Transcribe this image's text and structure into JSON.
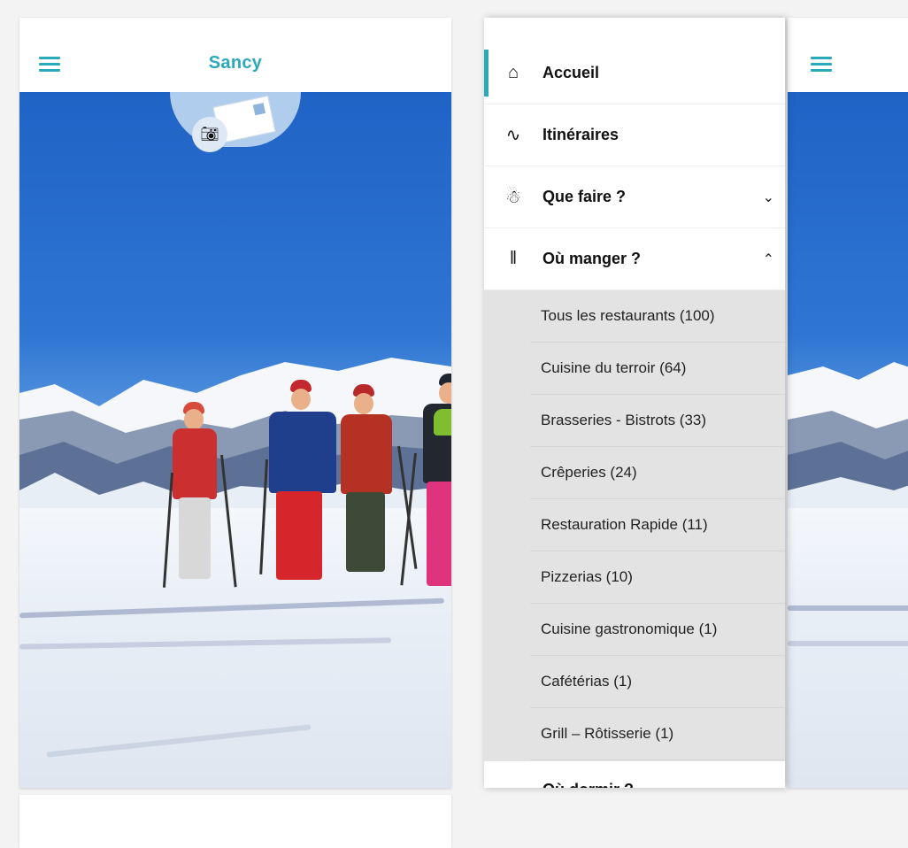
{
  "left_screen": {
    "title": "Sancy",
    "menu_icon": "hamburger-menu-icon",
    "camera_icon": "camera-icon",
    "postcard_icon": "postcard-icon"
  },
  "drawer": {
    "items": [
      {
        "label": "Accueil",
        "icon": "home-icon",
        "active": true
      },
      {
        "label": "Itinéraires",
        "icon": "route-icon"
      },
      {
        "label": "Que faire ?",
        "icon": "megaphone-icon",
        "chevron": "down"
      },
      {
        "label": "Où manger ?",
        "icon": "fork-knife-icon",
        "chevron": "up"
      }
    ],
    "submenu": [
      "Tous les restaurants (100)",
      "Cuisine du terroir (64)",
      "Brasseries - Bistrots (33)",
      "Crêperies (24)",
      "Restauration Rapide (11)",
      "Pizzerias (10)",
      "Cuisine gastronomique (1)",
      "Cafétérias (1)",
      "Grill – Rôtisserie (1)"
    ],
    "next_item": {
      "label": "Où dormir ?",
      "chevron": "down"
    }
  },
  "colors": {
    "accent": "#2aa9b8",
    "sky": "#2f76d3",
    "submenu_bg": "#e3e3e3"
  }
}
